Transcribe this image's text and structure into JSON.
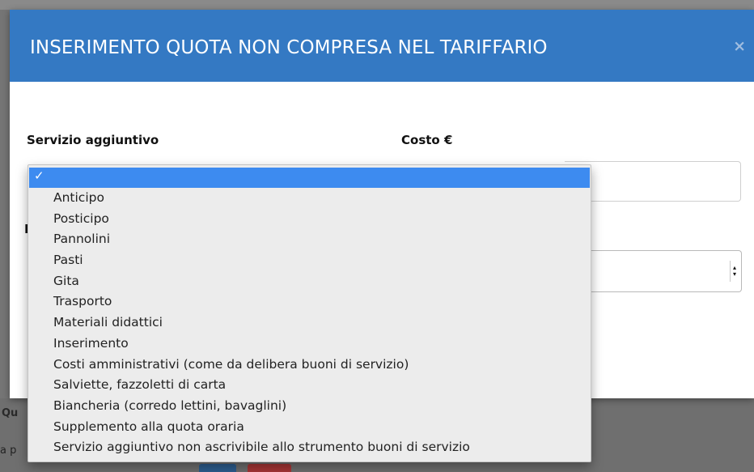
{
  "modal": {
    "title": "INSERIMENTO QUOTA NON COMPRESA NEL TARIFFARIO",
    "close_label": "×",
    "header_color": "#3479c3"
  },
  "form": {
    "servizio_label": "Servizio aggiuntivo",
    "costo_label": "Costo €",
    "hidden_label_fragment": "I"
  },
  "dropdown": {
    "selected_check": "✓",
    "selected_index": 0,
    "options": [
      "",
      "Anticipo",
      "Posticipo",
      "Pannolini",
      "Pasti",
      "Gita",
      "Trasporto",
      "Materiali didattici",
      "Inserimento",
      "Costi amministrativi (come da delibera buoni di servizio)",
      "Salviette, fazzoletti di carta",
      "Biancheria (corredo lettini, bavaglini)",
      "Supplemento alla quota oraria",
      "Servizio aggiuntivo non ascrivibile allo strumento buoni di servizio"
    ],
    "highlight_color": "#3d8bf0"
  },
  "background": {
    "fragment_qu": "Qu",
    "fragment_ap": "a p"
  }
}
